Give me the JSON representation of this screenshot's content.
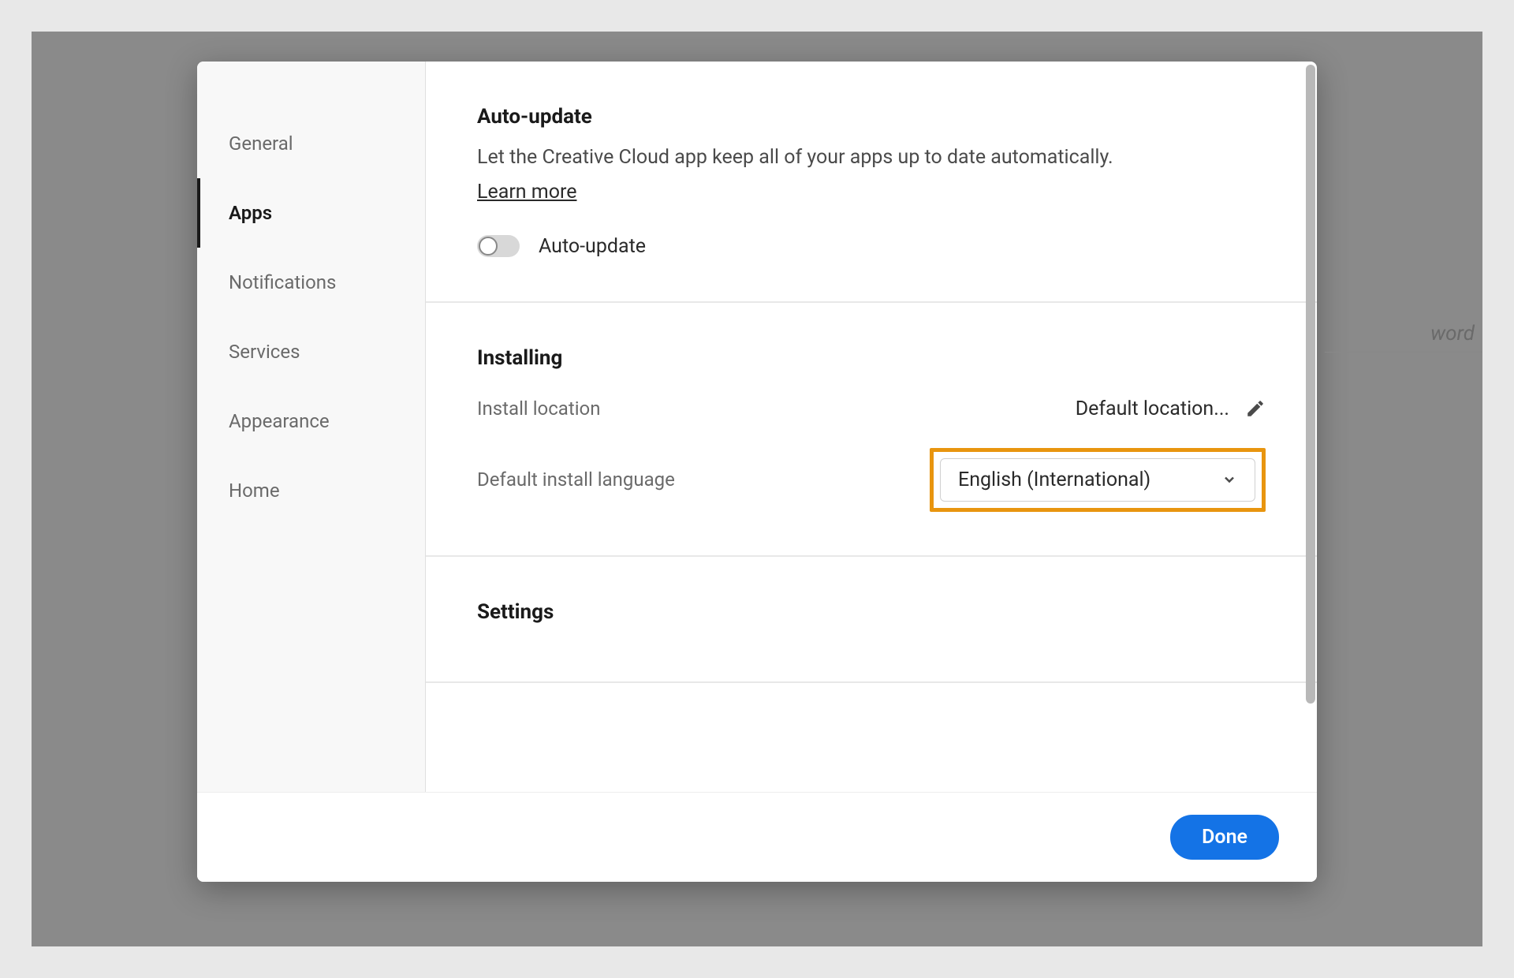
{
  "background": {
    "partial_text": "word"
  },
  "sidebar": {
    "items": [
      {
        "label": "General"
      },
      {
        "label": "Apps"
      },
      {
        "label": "Notifications"
      },
      {
        "label": "Services"
      },
      {
        "label": "Appearance"
      },
      {
        "label": "Home"
      }
    ]
  },
  "sections": {
    "auto_update": {
      "title": "Auto-update",
      "description": "Let the Creative Cloud app keep all of your apps up to date automatically.",
      "learn_more": "Learn more",
      "toggle_label": "Auto-update"
    },
    "installing": {
      "title": "Installing",
      "install_location_label": "Install location",
      "install_location_value": "Default location...",
      "language_label": "Default install language",
      "language_value": "English (International)"
    },
    "settings": {
      "title": "Settings"
    }
  },
  "footer": {
    "done": "Done"
  }
}
